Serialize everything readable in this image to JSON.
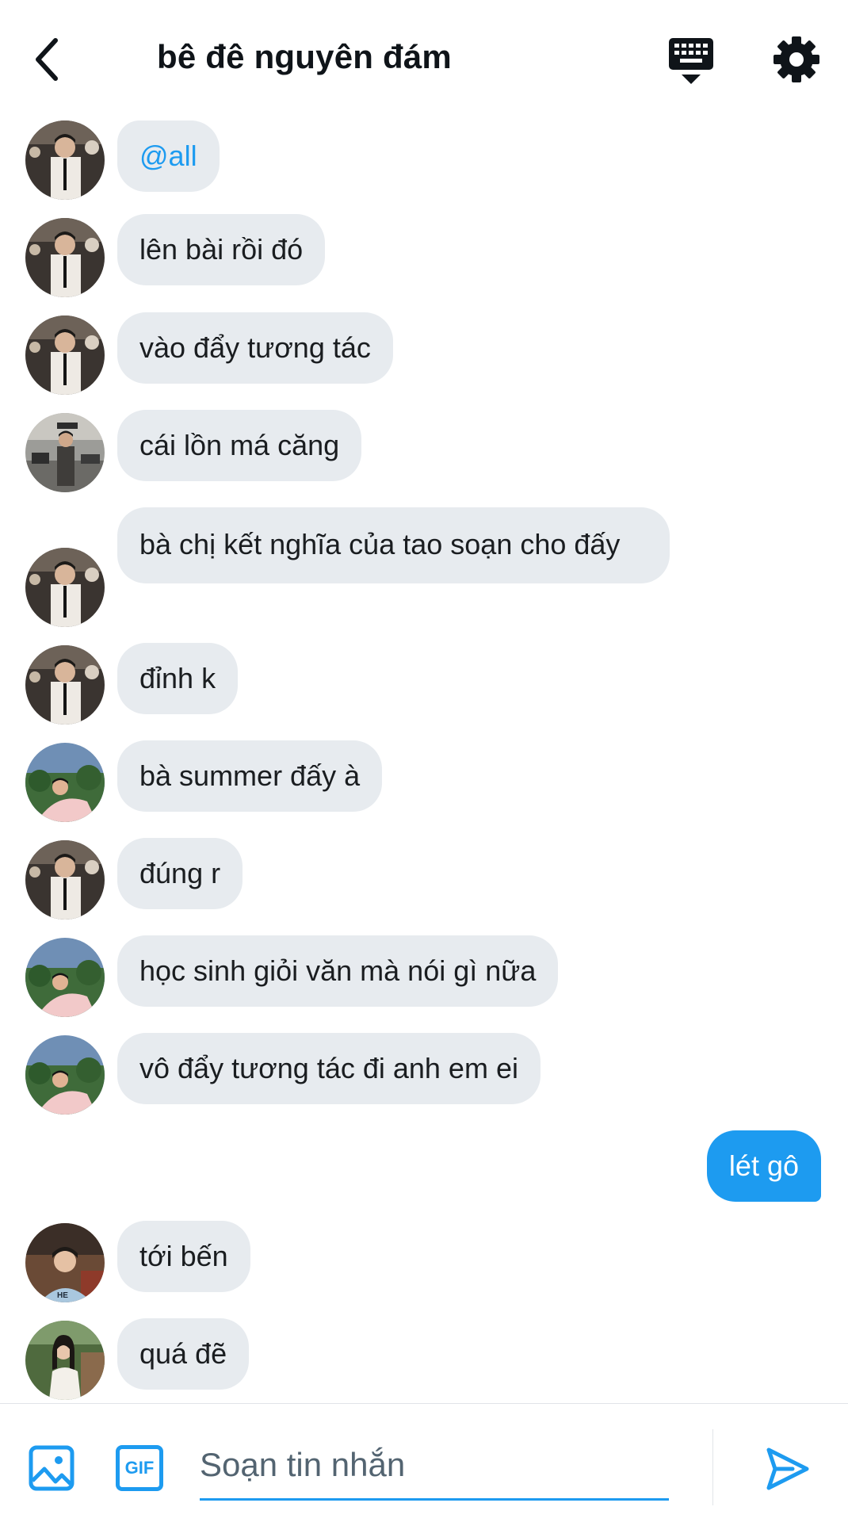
{
  "header": {
    "title": "bê đê nguyên đám",
    "icons": {
      "back": "back-arrow-icon",
      "keyboard": "keyboard-icon",
      "settings": "gear-icon"
    }
  },
  "messages": [
    {
      "text": "@all",
      "mention": true,
      "avatar": "avatar-a"
    },
    {
      "text": "lên bài rồi đó",
      "avatar": "avatar-a"
    },
    {
      "text": "vào đẩy tương tác",
      "avatar": "avatar-a"
    },
    {
      "text": "cái lồn má căng",
      "avatar": "avatar-b"
    },
    {
      "text": "bà chị kết nghĩa của tao soạn cho đấy",
      "avatar": "avatar-a"
    },
    {
      "text": "đỉnh k",
      "avatar": "avatar-a"
    },
    {
      "text": "bà summer đấy à",
      "avatar": "avatar-c"
    },
    {
      "text": "đúng r",
      "avatar": "avatar-a"
    },
    {
      "text": "học sinh giỏi văn mà nói gì nữa",
      "avatar": "avatar-c"
    },
    {
      "text": "vô đẩy tương tác đi anh em ei",
      "avatar": "avatar-c"
    },
    {
      "text": "lét gô",
      "own": true
    },
    {
      "text": "tới bến",
      "avatar": "avatar-d"
    },
    {
      "text": "quá đẽ",
      "avatar": "avatar-e"
    }
  ],
  "composer": {
    "placeholder": "Soạn tin nhắn",
    "value": "",
    "gif_label": "GIF",
    "icons": {
      "image": "image-icon",
      "gif": "gif-icon",
      "send": "send-icon"
    }
  },
  "colors": {
    "accent": "#1d9bf0",
    "bubble": "#e7ebef",
    "text": "#0f1419"
  }
}
